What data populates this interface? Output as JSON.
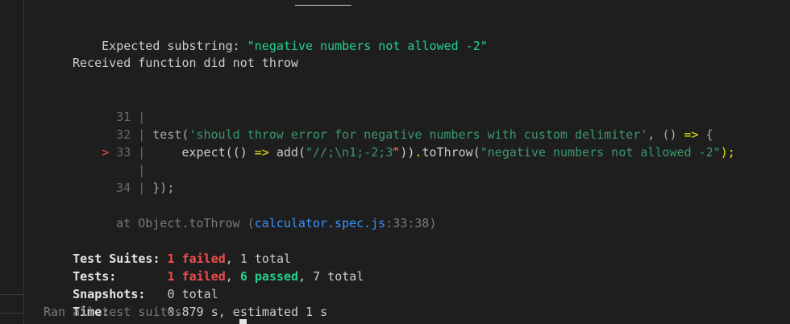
{
  "error": {
    "expected_label": "Expected substring: ",
    "expected_value": "\"negative numbers not allowed -2\"",
    "received_message": "Received function did not throw"
  },
  "code_frame": {
    "lines": [
      {
        "marker": "",
        "number": "31",
        "sep": "|",
        "text": ""
      },
      {
        "marker": "",
        "number": "32",
        "sep": "|",
        "test_kw": "test(",
        "test_str": "'should throw error for negative numbers with custom delimiter'",
        "test_rest": ", () ",
        "arrow": "=>",
        "brace": " {"
      },
      {
        "marker": ">",
        "number": "33",
        "sep": "|",
        "indent": "    ",
        "expect_kw": "expect(",
        "expect_fn": "() ",
        "expect_arrow": "=>",
        "add_call": " add(",
        "add_arg": "\"//;\\n1;-2;3\"",
        "close": "))",
        "dot": ".",
        "method": "toThrow",
        "open": "(",
        "msg": "\"negative numbers not allowed -2\"",
        "end": ");"
      },
      {
        "marker": "",
        "number": "",
        "sep": "|",
        "caret": "^"
      },
      {
        "marker": "",
        "number": "34",
        "sep": "|",
        "text": "});"
      }
    ]
  },
  "stack": {
    "prefix": "at Object.toThrow (",
    "file": "calculator.spec.js",
    "position": ":33:38",
    "suffix": ")"
  },
  "summary": {
    "suites_label": "Test Suites:",
    "suites_failed": "1 failed",
    "suites_total": ", 1 total",
    "tests_label": "Tests:",
    "tests_failed": "1 failed",
    "tests_sep": ", ",
    "tests_passed": "6 passed",
    "tests_total": ", 7 total",
    "snapshots_label": "Snapshots:",
    "snapshots_value": "0 total",
    "time_label": "Time:",
    "time_value": "0.879 s, estimated 1 s",
    "ran_all": "Ran all test suites."
  }
}
